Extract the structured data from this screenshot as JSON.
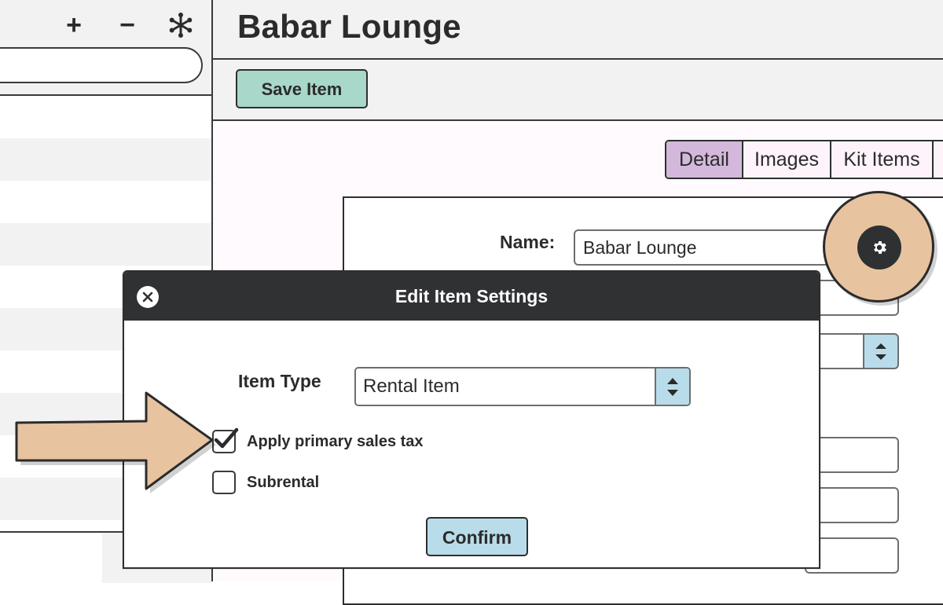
{
  "sidebar": {
    "toolbar": {
      "add": "+",
      "remove": "−",
      "options": "⁕"
    },
    "search": {
      "value": "",
      "placeholder": ""
    }
  },
  "header": {
    "title": "Babar Lounge"
  },
  "toolbar": {
    "save_label": "Save Item"
  },
  "tabs": [
    {
      "label": "Detail",
      "active": true
    },
    {
      "label": "Images"
    },
    {
      "label": "Kit Items"
    }
  ],
  "detail": {
    "name_label": "Name:",
    "name_value": "Babar Lounge",
    "settings_icon": "gear-icon"
  },
  "modal": {
    "title": "Edit Item Settings",
    "item_type_label": "Item Type",
    "item_type_value": "Rental Item",
    "checkboxes": [
      {
        "label": "Apply primary sales tax",
        "checked": true
      },
      {
        "label": "Subrental",
        "checked": false
      }
    ],
    "confirm_label": "Confirm"
  },
  "colors": {
    "save_button": "#a7d8c9",
    "active_tab": "#d3b8dc",
    "modal_header": "#303133",
    "select_arrows": "#b9dcea",
    "highlight": "#e8c3a0"
  }
}
